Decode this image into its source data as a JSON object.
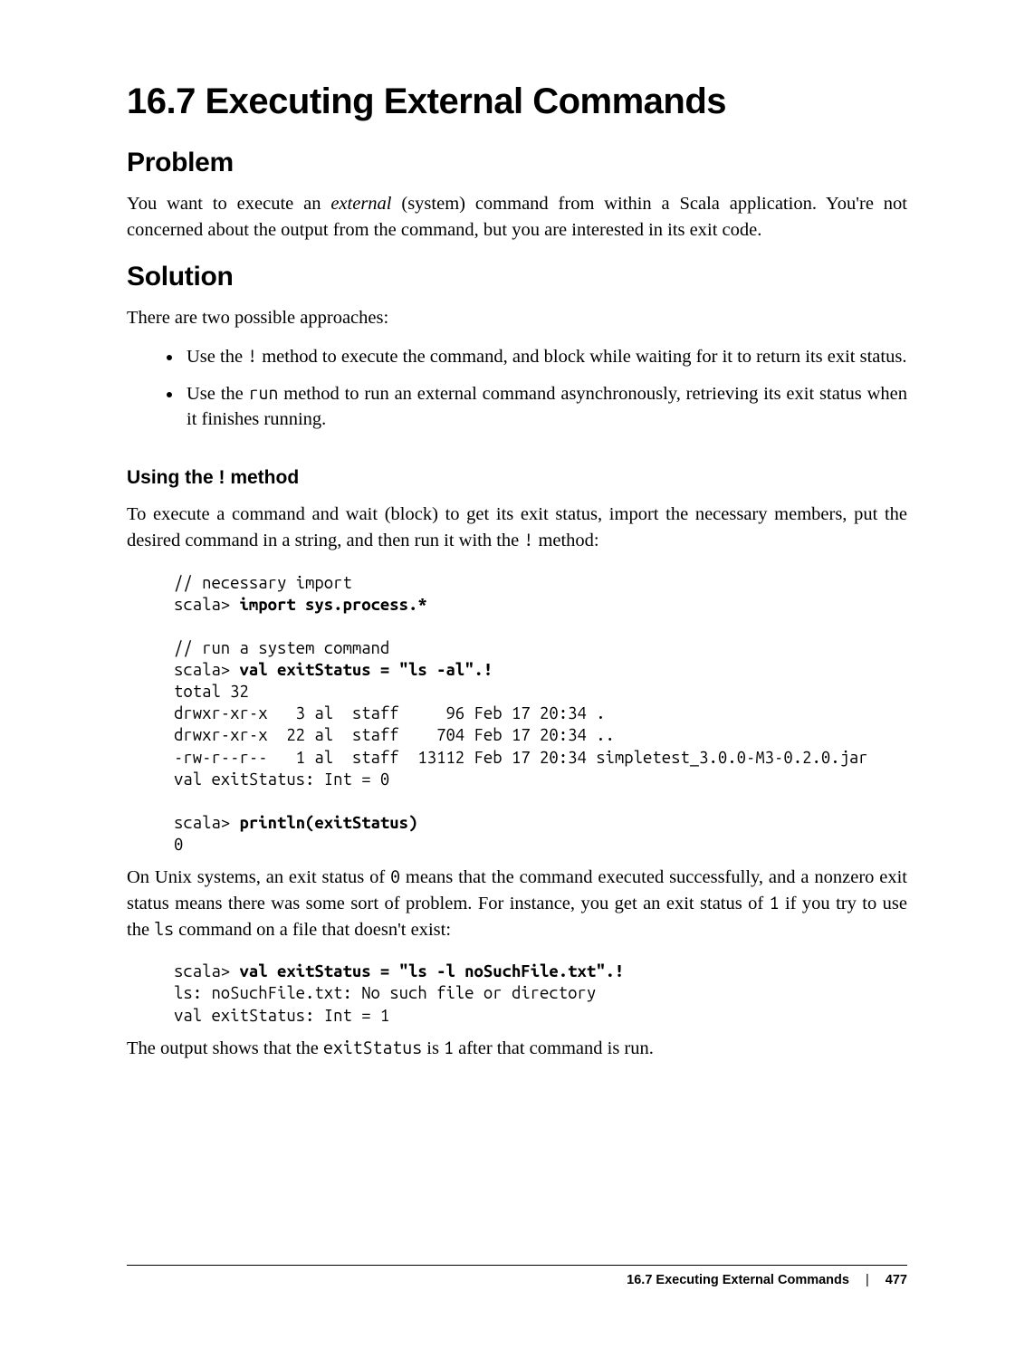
{
  "section_title": "16.7 Executing External Commands",
  "problem": {
    "heading": "Problem",
    "para": "You want to execute an external (system) command from within a Scala application. You're not concerned about the output from the command, but you are interested in its exit code.",
    "em_word": "external"
  },
  "solution": {
    "heading": "Solution",
    "intro": "There are two possible approaches:",
    "bullets": {
      "b1_a": "Use the ",
      "b1_code": "!",
      "b1_b": " method to execute the command, and block while waiting for it to return its exit status.",
      "b2_a": "Use the ",
      "b2_code": "run",
      "b2_b": " method to run an external command asynchronously, retrieving its exit status when it finishes running."
    }
  },
  "using_bang": {
    "heading": "Using the ! method",
    "para_a": "To execute a command and wait (block) to get its exit status, import the necessary members, put the desired command in a string, and then run it with the ",
    "code1": "!",
    "para_b": " method:"
  },
  "code_block_1": {
    "l01": "// necessary import",
    "l02a": "scala> ",
    "l02b": "import sys.process.*",
    "l03": "",
    "l04": "// run a system command",
    "l05a": "scala> ",
    "l05b": "val exitStatus = \"ls -al\".!",
    "l06": "total 32",
    "l07": "drwxr-xr-x   3 al  staff     96 Feb 17 20:34 .",
    "l08": "drwxr-xr-x  22 al  staff    704 Feb 17 20:34 ..",
    "l09": "-rw-r--r--   1 al  staff  13112 Feb 17 20:34 simpletest_3.0.0-M3-0.2.0.jar",
    "l10": "val exitStatus: Int = 0",
    "l11": "",
    "l12a": "scala> ",
    "l12b": "println(exitStatus)",
    "l13": "0"
  },
  "mid_para": {
    "a": "On Unix systems, an exit status of ",
    "code0": "0",
    "b": " means that the command executed successfully, and a nonzero exit status means there was some sort of problem. For instance, you get an exit status of ",
    "code1": "1",
    "c": " if you try to use the ",
    "codels": "ls",
    "d": " command on a file that doesn't exist:"
  },
  "code_block_2": {
    "l1a": "scala> ",
    "l1b": "val exitStatus = \"ls -l noSuchFile.txt\".!",
    "l2": "ls: noSuchFile.txt: No such file or directory",
    "l3": "val exitStatus: Int = 1"
  },
  "last_para": {
    "a": "The output shows that the ",
    "code": "exitStatus",
    "b": " is ",
    "code1": "1",
    "c": " after that command is run."
  },
  "footer": {
    "title": "16.7 Executing External Commands",
    "sep": "|",
    "page": "477"
  }
}
